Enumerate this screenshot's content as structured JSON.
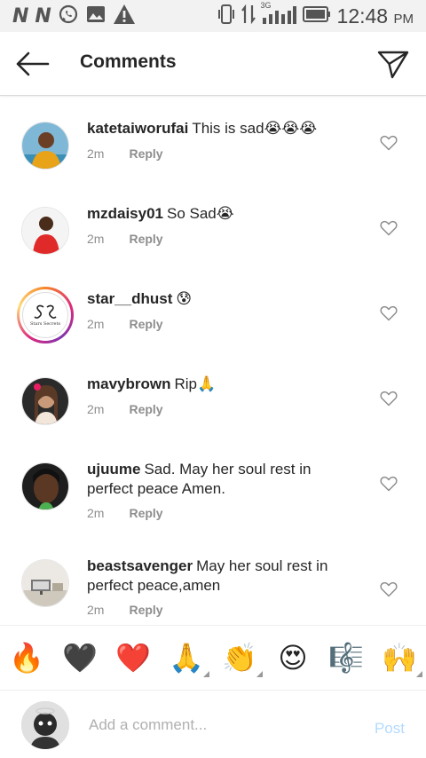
{
  "status_bar": {
    "left_letters": [
      "N",
      "N"
    ],
    "left_icons": [
      "whatsapp-icon",
      "image-icon",
      "alert-icon"
    ],
    "right_icons": [
      "vibrate-icon",
      "data-transfer-icon",
      "signal-icon",
      "battery-icon"
    ],
    "network": "3G",
    "time": "12:48",
    "ampm": "PM"
  },
  "header": {
    "title": "Comments",
    "back_icon": "back-arrow-icon",
    "send_icon": "send-icon"
  },
  "comments": [
    {
      "username": "katetaiworufai",
      "text": "This is sad",
      "emoji": "😭😭😭",
      "time": "2m",
      "reply": "Reply"
    },
    {
      "username": "mzdaisy01",
      "text": "So Sad",
      "emoji": "😭",
      "time": "2m",
      "reply": "Reply"
    },
    {
      "username": "star__dhust",
      "text": "",
      "emoji": "😰",
      "time": "2m",
      "reply": "Reply"
    },
    {
      "username": "mavybrown",
      "text": "Rip",
      "emoji": "🙏",
      "time": "2m",
      "reply": "Reply"
    },
    {
      "username": "ujuume",
      "text": "Sad. May her soul rest in perfect peace Amen.",
      "emoji": "",
      "time": "2m",
      "reply": "Reply"
    },
    {
      "username": "beastsavenger",
      "text": "May her soul rest in perfect peace,amen",
      "emoji": "",
      "time": "2m",
      "reply": "Reply"
    }
  ],
  "avatar_logo_text": "Stars Secrets",
  "reactions": [
    "🔥",
    "🖤",
    "❤️",
    "🙏",
    "👏",
    "😍",
    "🎼",
    "🙌"
  ],
  "input": {
    "placeholder": "Add a comment...",
    "post_label": "Post"
  },
  "colors": {
    "link_disabled": "#b3dbff",
    "meta_gray": "#8e8e8e",
    "text": "#262626"
  }
}
